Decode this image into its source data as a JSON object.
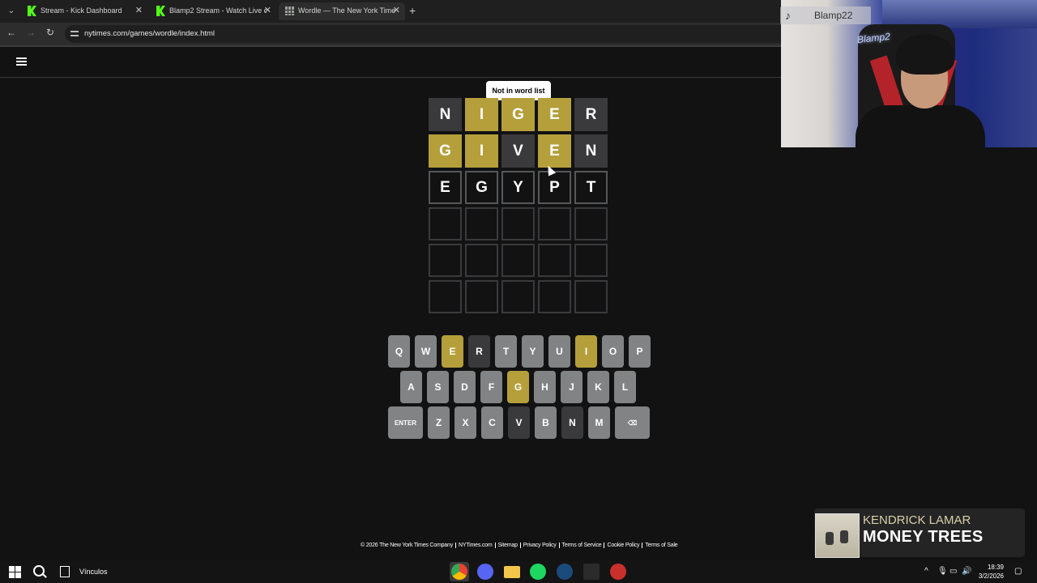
{
  "browser": {
    "tabs": [
      {
        "title": "Stream - Kick Dashboard",
        "favicon": "kick-icon",
        "active": false
      },
      {
        "title": "Blamp2 Stream - Watch Live on",
        "favicon": "kick-icon",
        "active": false
      },
      {
        "title": "Wordle — The New York Times",
        "favicon": "wordle-grid-icon",
        "active": true
      }
    ],
    "url": "nytimes.com/games/wordle/index.html"
  },
  "wordle": {
    "toast": "Not in word list",
    "rows": [
      [
        {
          "l": "N",
          "s": "absent"
        },
        {
          "l": "I",
          "s": "present"
        },
        {
          "l": "G",
          "s": "present"
        },
        {
          "l": "E",
          "s": "present"
        },
        {
          "l": "R",
          "s": "absent"
        }
      ],
      [
        {
          "l": "G",
          "s": "present"
        },
        {
          "l": "I",
          "s": "present"
        },
        {
          "l": "V",
          "s": "absent"
        },
        {
          "l": "E",
          "s": "present"
        },
        {
          "l": "N",
          "s": "absent"
        }
      ],
      [
        {
          "l": "E",
          "s": "tbd"
        },
        {
          "l": "G",
          "s": "tbd"
        },
        {
          "l": "Y",
          "s": "tbd"
        },
        {
          "l": "P",
          "s": "tbd"
        },
        {
          "l": "T",
          "s": "tbd"
        }
      ],
      [
        {
          "l": "",
          "s": "empty"
        },
        {
          "l": "",
          "s": "empty"
        },
        {
          "l": "",
          "s": "empty"
        },
        {
          "l": "",
          "s": "empty"
        },
        {
          "l": "",
          "s": "empty"
        }
      ],
      [
        {
          "l": "",
          "s": "empty"
        },
        {
          "l": "",
          "s": "empty"
        },
        {
          "l": "",
          "s": "empty"
        },
        {
          "l": "",
          "s": "empty"
        },
        {
          "l": "",
          "s": "empty"
        }
      ],
      [
        {
          "l": "",
          "s": "empty"
        },
        {
          "l": "",
          "s": "empty"
        },
        {
          "l": "",
          "s": "empty"
        },
        {
          "l": "",
          "s": "empty"
        },
        {
          "l": "",
          "s": "empty"
        }
      ]
    ],
    "keyboard": [
      [
        {
          "k": "Q"
        },
        {
          "k": "W"
        },
        {
          "k": "E",
          "s": "present"
        },
        {
          "k": "R",
          "s": "absent"
        },
        {
          "k": "T"
        },
        {
          "k": "Y"
        },
        {
          "k": "U"
        },
        {
          "k": "I",
          "s": "present"
        },
        {
          "k": "O"
        },
        {
          "k": "P"
        }
      ],
      [
        {
          "k": "A"
        },
        {
          "k": "S"
        },
        {
          "k": "D"
        },
        {
          "k": "F"
        },
        {
          "k": "G",
          "s": "present"
        },
        {
          "k": "H"
        },
        {
          "k": "J"
        },
        {
          "k": "K"
        },
        {
          "k": "L"
        }
      ],
      [
        {
          "k": "ENTER",
          "wide": true
        },
        {
          "k": "Z"
        },
        {
          "k": "X"
        },
        {
          "k": "C"
        },
        {
          "k": "V",
          "s": "absent"
        },
        {
          "k": "B"
        },
        {
          "k": "N",
          "s": "absent"
        },
        {
          "k": "M"
        },
        {
          "k": "⌫",
          "wide": true
        }
      ]
    ],
    "footer": [
      "© 2026 The New York Times Company",
      "NYTimes.com",
      "Sitemap",
      "Privacy Policy",
      "Terms of Service",
      "Cookie Policy",
      "Terms of Sale"
    ]
  },
  "overlay": {
    "cam_username": "Blamp22",
    "neon_sign": "Blamp2",
    "now_playing_artist": "KENDRICK LAMAR",
    "now_playing_title": "MONEY TREES"
  },
  "taskbar": {
    "links_label": "Vínculos",
    "time": "18:39",
    "date": "3/2/2026"
  },
  "colors": {
    "present": "#b59f3b",
    "absent": "#3a3a3c",
    "key": "#818384",
    "bg": "#121213"
  }
}
